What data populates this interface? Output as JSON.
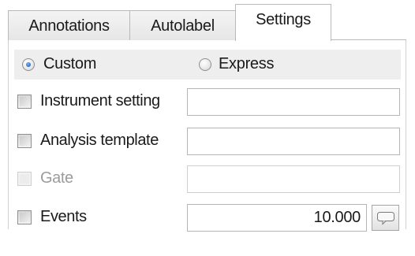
{
  "tabs": [
    {
      "label": "Annotations",
      "active": false
    },
    {
      "label": "Autolabel",
      "active": false
    },
    {
      "label": "Settings",
      "active": true
    }
  ],
  "mode": {
    "options": [
      {
        "label": "Custom",
        "checked": true
      },
      {
        "label": "Express",
        "checked": false
      }
    ]
  },
  "settings": {
    "instrument_setting": {
      "label": "Instrument setting",
      "checked": false,
      "value": ""
    },
    "analysis_template": {
      "label": "Analysis template",
      "checked": false,
      "value": ""
    },
    "gate": {
      "label": "Gate",
      "checked": false,
      "enabled": false,
      "value": ""
    },
    "events": {
      "label": "Events",
      "checked": false,
      "value": "10.000",
      "button_icon": "speech-bubble-icon"
    }
  },
  "colors": {
    "radio_dot": "#2d6fc2",
    "disabled_text": "#9b9b9b",
    "mode_row_bg": "#eeeeee"
  }
}
